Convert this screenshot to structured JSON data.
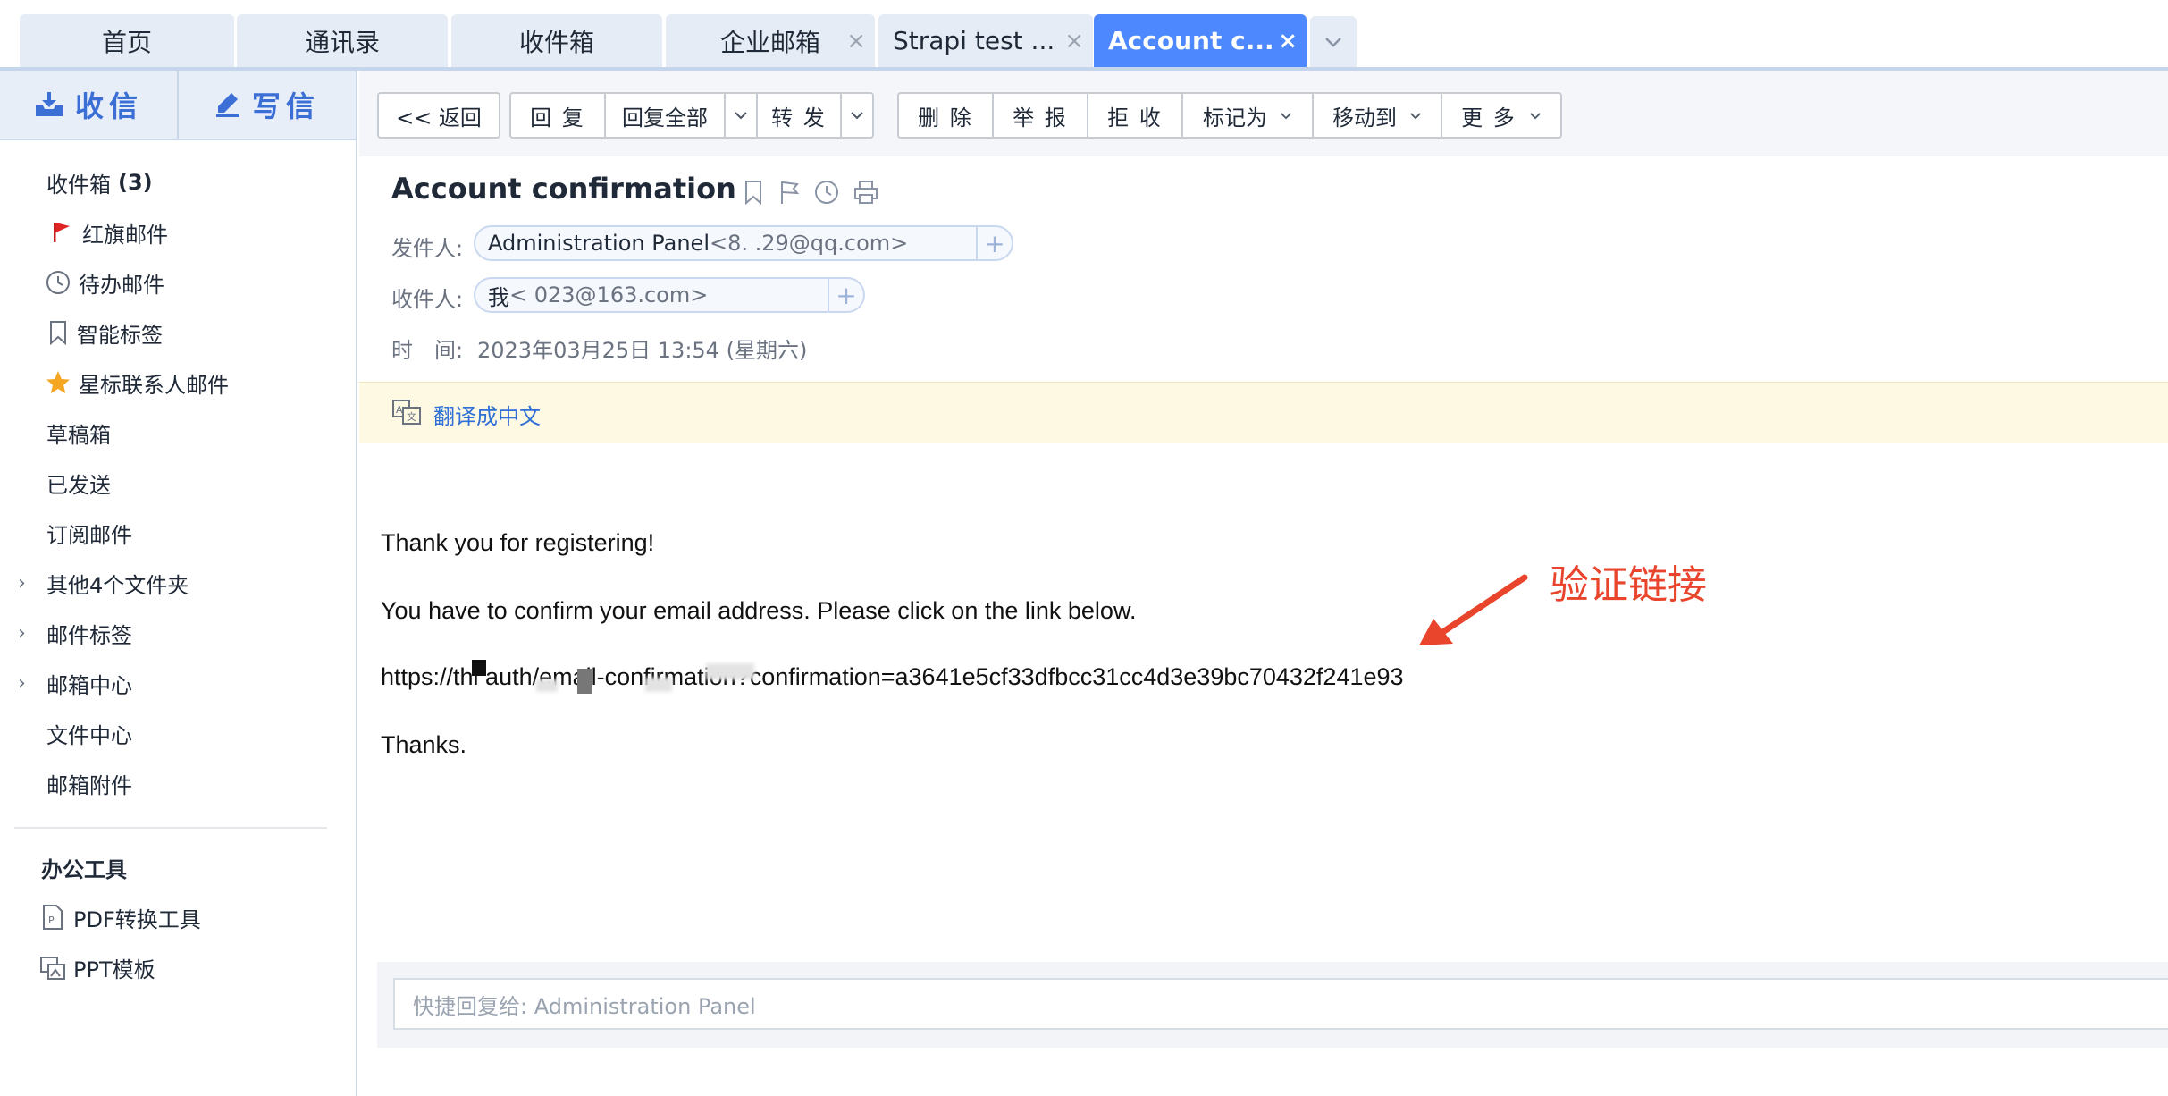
{
  "tabs": [
    {
      "label": "首页",
      "closable": false,
      "active": false
    },
    {
      "label": "通讯录",
      "closable": false,
      "active": false
    },
    {
      "label": "收件箱",
      "closable": false,
      "active": false
    },
    {
      "label": "企业邮箱",
      "closable": true,
      "active": false
    },
    {
      "label": "Strapi test ...",
      "closable": true,
      "active": false
    },
    {
      "label": "Account c...",
      "closable": true,
      "active": true
    }
  ],
  "compose": {
    "receive": "收信",
    "write": "写信"
  },
  "sidebar": {
    "inbox_label": "收件箱",
    "inbox_count": "(3)",
    "items": [
      {
        "label": "红旗邮件",
        "icon": "red-flag-icon"
      },
      {
        "label": "待办邮件",
        "icon": "clock-icon"
      },
      {
        "label": "智能标签",
        "icon": "bookmark-icon"
      },
      {
        "label": "星标联系人邮件",
        "icon": "star-icon"
      },
      {
        "label": "草稿箱"
      },
      {
        "label": "已发送"
      },
      {
        "label": "订阅邮件"
      },
      {
        "label": "其他4个文件夹",
        "expandable": true
      },
      {
        "label": "邮件标签",
        "expandable": true
      },
      {
        "label": "邮箱中心",
        "expandable": true
      },
      {
        "label": "文件中心"
      },
      {
        "label": "邮箱附件"
      }
    ],
    "tools_heading": "办公工具",
    "tools": [
      {
        "label": "PDF转换工具",
        "icon": "pdf-file-icon"
      },
      {
        "label": "PPT模板",
        "icon": "ppt-template-icon"
      }
    ]
  },
  "toolbar": {
    "back": "<< 返回",
    "reply": "回 复",
    "reply_all": "回复全部",
    "forward": "转 发",
    "delete": "删 除",
    "report": "举 报",
    "reject": "拒 收",
    "mark_as": "标记为",
    "move_to": "移动到",
    "more": "更 多"
  },
  "mail": {
    "subject": "Account confirmation",
    "from_label": "发件人:",
    "from_name": "Administration Panel",
    "from_addr": "<8.       .29@qq.com>",
    "to_label": "收件人:",
    "to_name": "我",
    "to_addr": "<          023@163.com>",
    "time_label": "时　间:",
    "time_value": "2023年03月25日 13:54 (星期六)",
    "translate": "翻译成中文",
    "body": {
      "line1": "Thank you for registering!",
      "line2": "You have to confirm your email address. Please click on the link below.",
      "link": "https://thi           auth/email-confirmation?confirmation=a3641e5cf33dfbcc31cc4d3e39bc70432f241e93",
      "closing": "Thanks."
    },
    "annotation": "验证链接"
  },
  "quick_reply": {
    "placeholder": "快捷回复给: Administration Panel"
  },
  "colors": {
    "accent": "#4d88ff",
    "annotation": "#e8452c",
    "link": "#2f6fd6"
  }
}
